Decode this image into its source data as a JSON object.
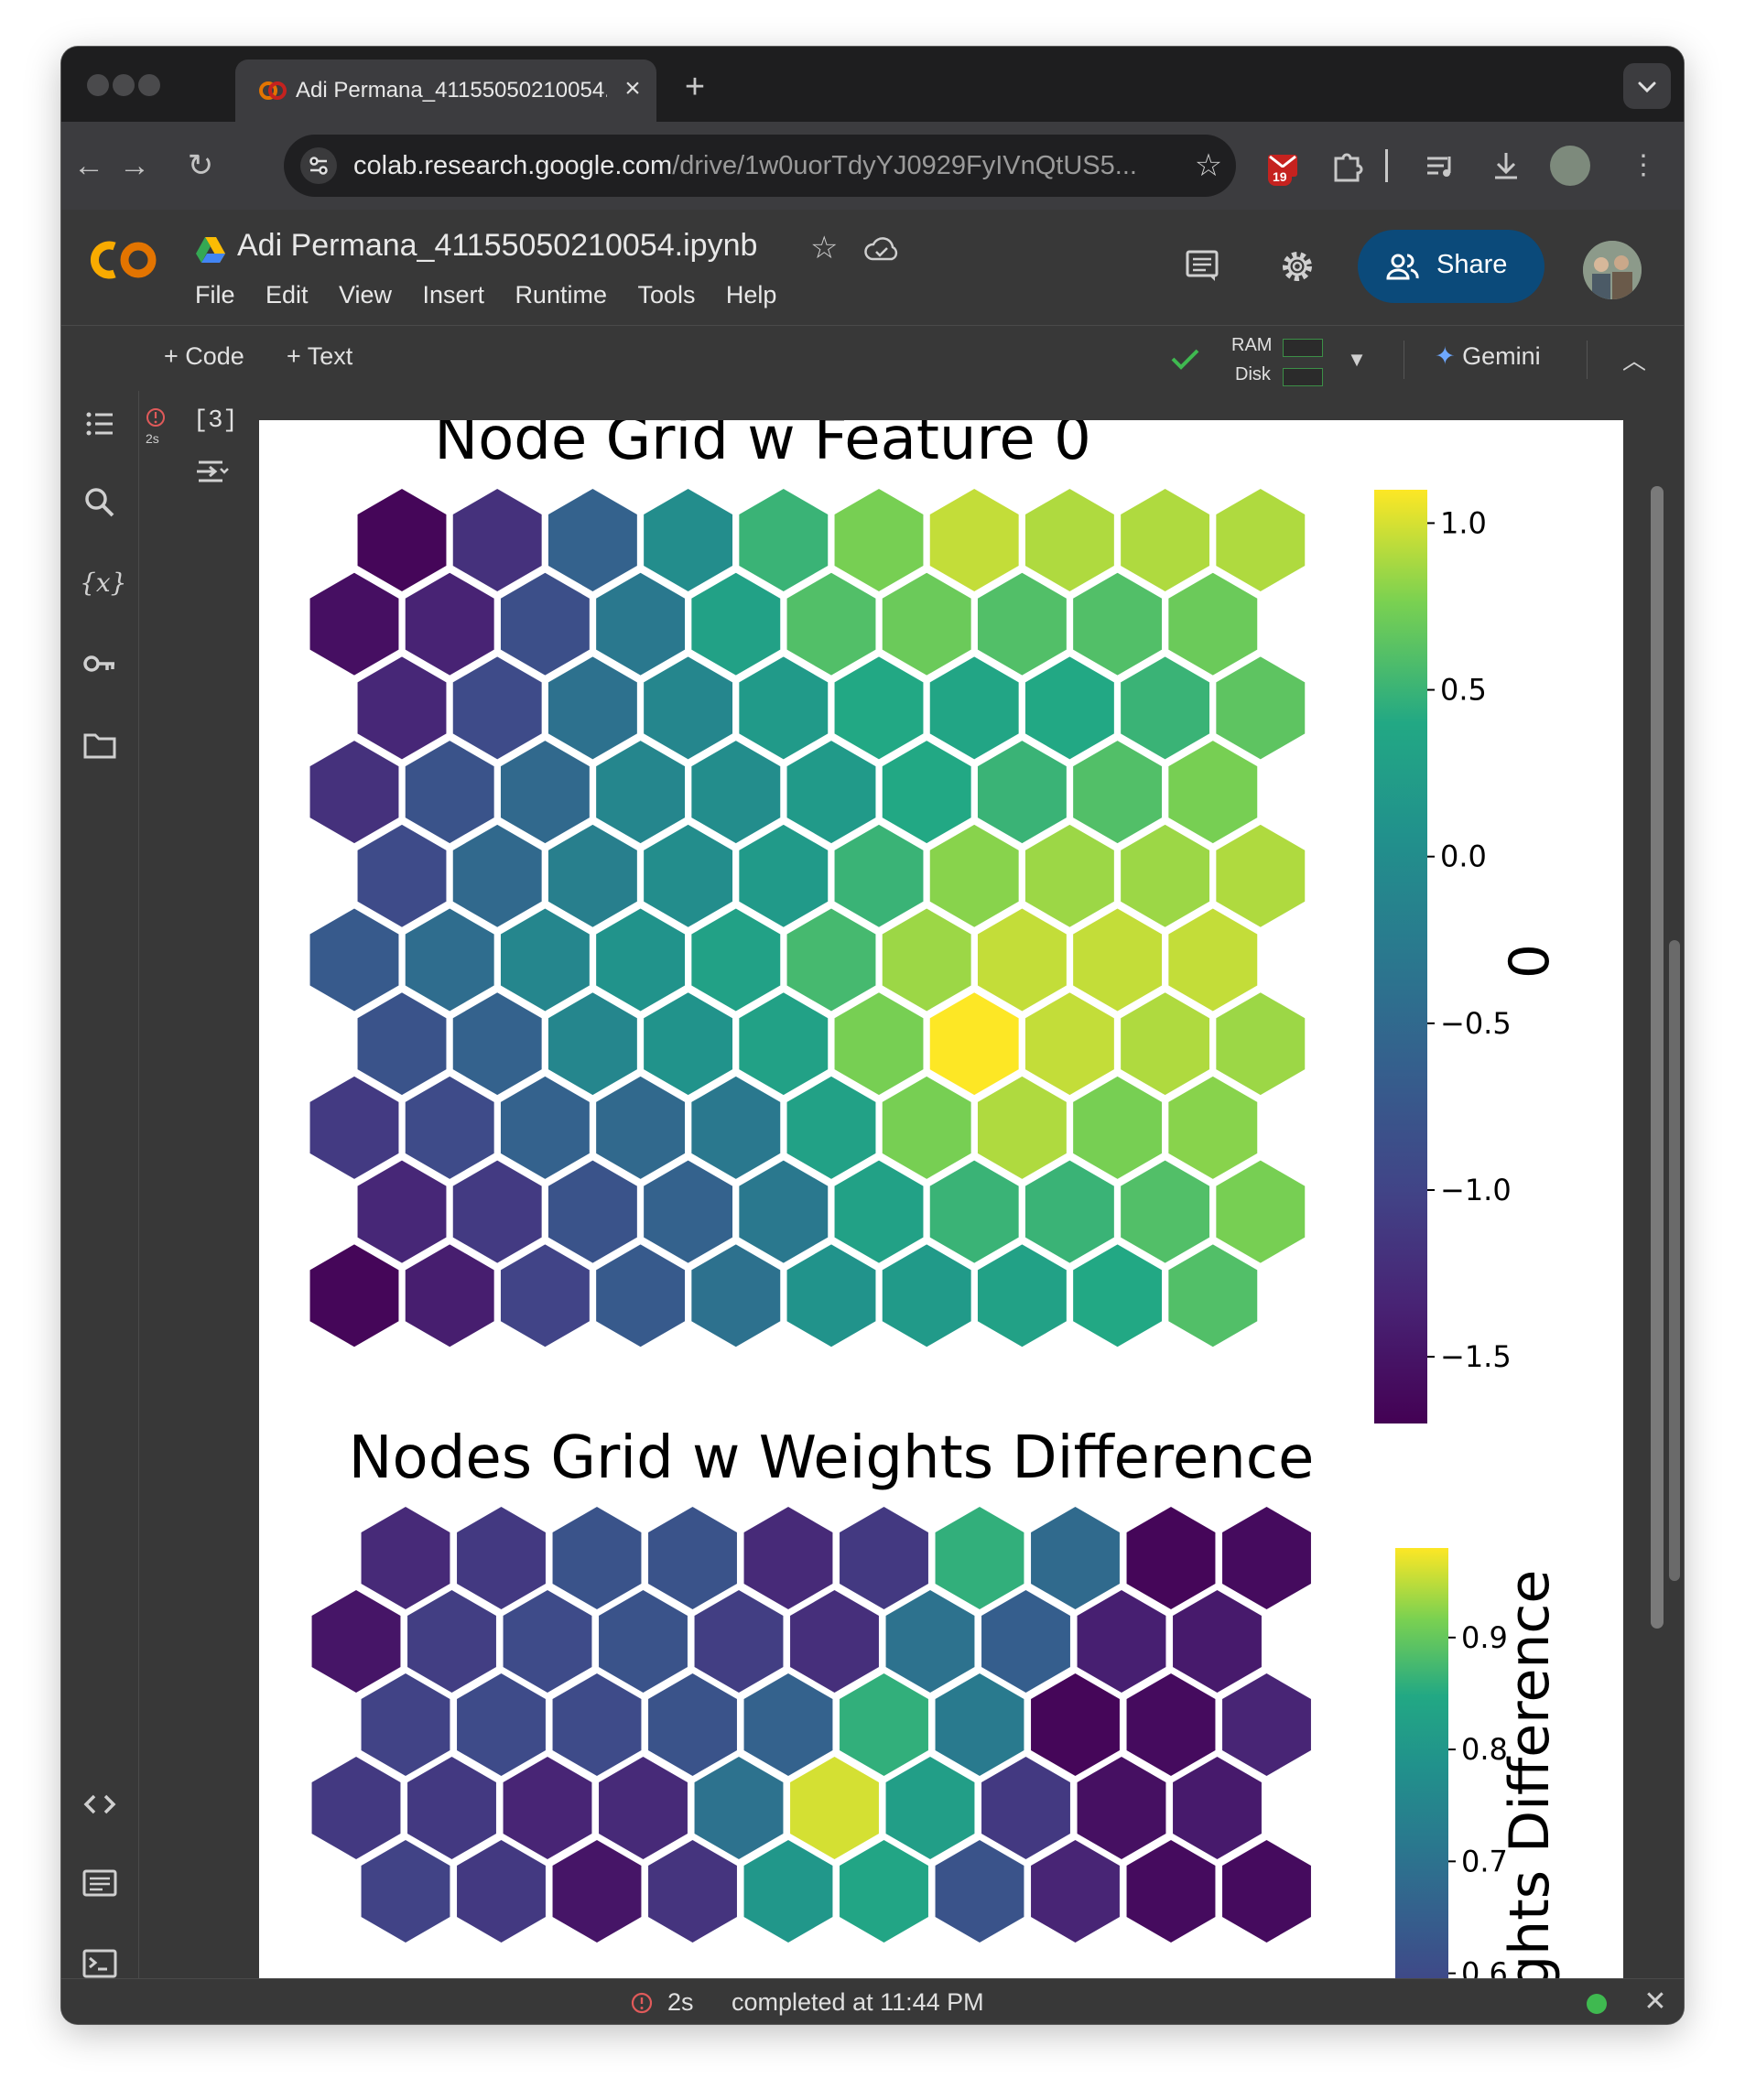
{
  "browser": {
    "tab_title": "Adi Permana_41155050210054.ipynb",
    "url_host": "colab.research.google.com",
    "url_path": "/drive/1w0uorTdyYJ0929FyIVnQtUS5...",
    "notification_count": "19"
  },
  "colab": {
    "doc_title": "Adi Permana_41155050210054.ipynb",
    "menu": [
      "File",
      "Edit",
      "View",
      "Insert",
      "Runtime",
      "Tools",
      "Help"
    ],
    "share_label": "Share",
    "add_code_label": "+ Code",
    "add_text_label": "+ Text",
    "ram_label": "RAM",
    "disk_label": "Disk",
    "gemini_label": "Gemini"
  },
  "cell": {
    "exec_count": "[3]",
    "exec_time": "2s"
  },
  "status": {
    "time": "2s",
    "message": "completed at 11:44 PM"
  },
  "chart_data": [
    {
      "type": "heatmap",
      "title": "Node Grid w Feature 0",
      "colorbar_label": "0",
      "colormap": "viridis",
      "vmin": -1.7,
      "vmax": 1.1,
      "colorbar_ticks": [
        "1.0",
        "0.5",
        "0.0",
        "−0.5",
        "−1.0",
        "−1.5"
      ],
      "rows": [
        [
          -1.65,
          -1.2,
          -0.6,
          0.0,
          0.5,
          0.75,
          0.95,
          0.9,
          0.9,
          0.9
        ],
        [
          -1.55,
          -1.35,
          -0.85,
          -0.3,
          0.3,
          0.6,
          0.7,
          0.6,
          0.6,
          0.7
        ],
        [
          -1.3,
          -0.9,
          -0.4,
          -0.1,
          0.2,
          0.4,
          0.35,
          0.4,
          0.5,
          0.65
        ],
        [
          -1.2,
          -0.8,
          -0.5,
          -0.1,
          0.0,
          0.2,
          0.4,
          0.5,
          0.6,
          0.75
        ],
        [
          -0.9,
          -0.5,
          -0.2,
          0.0,
          0.2,
          0.5,
          0.8,
          0.85,
          0.85,
          0.9
        ],
        [
          -0.7,
          -0.45,
          -0.1,
          0.1,
          0.3,
          0.55,
          0.85,
          0.95,
          0.95,
          0.95
        ],
        [
          -0.8,
          -0.6,
          -0.1,
          0.1,
          0.3,
          0.75,
          1.1,
          0.95,
          0.9,
          0.85
        ],
        [
          -1.1,
          -0.9,
          -0.6,
          -0.5,
          -0.3,
          0.3,
          0.75,
          0.9,
          0.75,
          0.8
        ],
        [
          -1.3,
          -1.1,
          -0.8,
          -0.6,
          -0.3,
          0.3,
          0.5,
          0.5,
          0.6,
          0.75
        ],
        [
          -1.65,
          -1.4,
          -1.0,
          -0.7,
          -0.4,
          0.1,
          0.2,
          0.3,
          0.4,
          0.6
        ]
      ]
    },
    {
      "type": "heatmap",
      "title": "Nodes Grid w Weights Difference",
      "colorbar_label": "Weights Difference",
      "colormap": "viridis",
      "vmin": 0.45,
      "vmax": 0.98,
      "colorbar_ticks": [
        "0.9",
        "0.8",
        "0.7",
        "0.6"
      ],
      "rows": [
        [
          0.53,
          0.56,
          0.62,
          0.62,
          0.53,
          0.56,
          0.86,
          0.68,
          0.46,
          0.47
        ],
        [
          0.49,
          0.57,
          0.6,
          0.62,
          0.57,
          0.54,
          0.7,
          0.65,
          0.51,
          0.5
        ],
        [
          0.58,
          0.6,
          0.6,
          0.62,
          0.66,
          0.86,
          0.72,
          0.46,
          0.47,
          0.52
        ],
        [
          0.56,
          0.56,
          0.52,
          0.53,
          0.7,
          0.96,
          0.82,
          0.56,
          0.48,
          0.5
        ],
        [
          0.58,
          0.56,
          0.49,
          0.55,
          0.8,
          0.84,
          0.62,
          0.52,
          0.47,
          0.47
        ]
      ]
    }
  ]
}
